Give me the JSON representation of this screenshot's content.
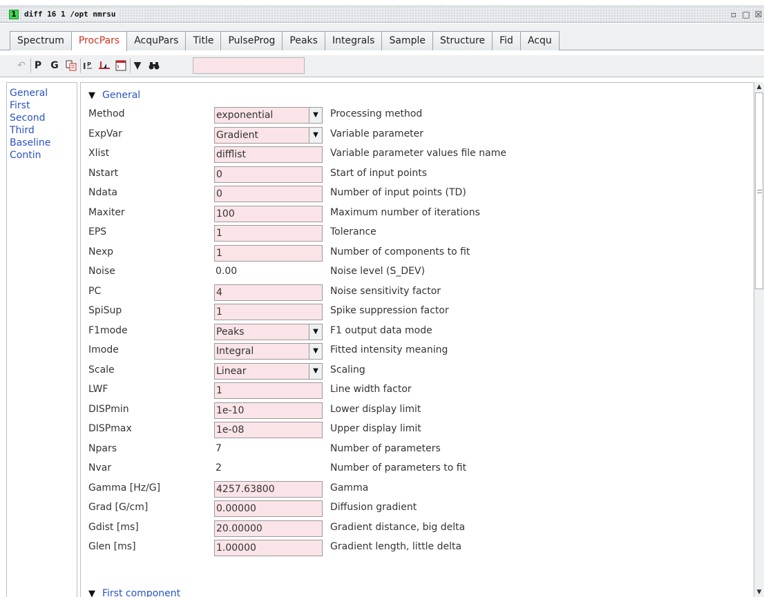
{
  "window": {
    "badge": "1",
    "title": "diff 16 1 /opt nmrsu"
  },
  "tabs": [
    {
      "label": "Spectrum",
      "active": false
    },
    {
      "label": "ProcPars",
      "active": true
    },
    {
      "label": "AcquPars",
      "active": false
    },
    {
      "label": "Title",
      "active": false
    },
    {
      "label": "PulseProg",
      "active": false
    },
    {
      "label": "Peaks",
      "active": false
    },
    {
      "label": "Integrals",
      "active": false
    },
    {
      "label": "Sample",
      "active": false
    },
    {
      "label": "Structure",
      "active": false
    },
    {
      "label": "Fid",
      "active": false
    },
    {
      "label": "Acqu",
      "active": false
    }
  ],
  "toolbar": {
    "p_label": "P",
    "g_label": "G",
    "search_value": ""
  },
  "sidenav": [
    "General",
    "First",
    "Second",
    "Third",
    "Baseline",
    "Contin"
  ],
  "sections": {
    "general": "General",
    "first_component": "First component"
  },
  "params": [
    {
      "label": "Method",
      "kind": "combo",
      "value": "exponential",
      "desc": "Processing method"
    },
    {
      "label": "ExpVar",
      "kind": "combo",
      "value": "Gradient",
      "desc": "Variable parameter"
    },
    {
      "label": "Xlist",
      "kind": "field",
      "value": "difflist",
      "desc": "Variable parameter values file name"
    },
    {
      "label": "Nstart",
      "kind": "field",
      "value": "0",
      "desc": "Start of input points"
    },
    {
      "label": "Ndata",
      "kind": "field",
      "value": "0",
      "desc": "Number of input points (TD)"
    },
    {
      "label": "Maxiter",
      "kind": "field",
      "value": "100",
      "desc": "Maximum number of iterations"
    },
    {
      "label": "EPS",
      "kind": "field",
      "value": "1",
      "desc": "Tolerance"
    },
    {
      "label": "Nexp",
      "kind": "field",
      "value": "1",
      "desc": "Number of components to fit"
    },
    {
      "label": "Noise",
      "kind": "plain",
      "value": "0.00",
      "desc": "Noise level (S_DEV)"
    },
    {
      "label": "PC",
      "kind": "field",
      "value": "4",
      "desc": "Noise sensitivity factor"
    },
    {
      "label": "SpiSup",
      "kind": "field",
      "value": "1",
      "desc": "Spike suppression factor"
    },
    {
      "label": "F1mode",
      "kind": "combo",
      "value": "Peaks",
      "desc": "F1 output data mode"
    },
    {
      "label": "Imode",
      "kind": "combo",
      "value": "Integral",
      "desc": "Fitted intensity meaning"
    },
    {
      "label": "Scale",
      "kind": "combo",
      "value": "Linear",
      "desc": "Scaling"
    },
    {
      "label": "LWF",
      "kind": "field",
      "value": "1",
      "desc": "Line width factor"
    },
    {
      "label": "DISPmin",
      "kind": "field",
      "value": "1e-10",
      "desc": "Lower display limit"
    },
    {
      "label": "DISPmax",
      "kind": "field",
      "value": "1e-08",
      "desc": "Upper display limit"
    },
    {
      "label": "Npars",
      "kind": "plain",
      "value": "7",
      "desc": "Number of parameters"
    },
    {
      "label": "Nvar",
      "kind": "plain",
      "value": "2",
      "desc": "Number of parameters to fit"
    },
    {
      "label": "Gamma [Hz/G]",
      "kind": "field",
      "value": "4257.63800",
      "desc": "Gamma"
    },
    {
      "label": "Grad [G/cm]",
      "kind": "field",
      "value": "0.00000",
      "desc": "Diffusion gradient"
    },
    {
      "label": "Gdist [ms]",
      "kind": "field",
      "value": "20.00000",
      "desc": "Gradient distance, big delta"
    },
    {
      "label": "Glen [ms]",
      "kind": "field",
      "value": "1.00000",
      "desc": "Gradient length, little delta"
    }
  ]
}
